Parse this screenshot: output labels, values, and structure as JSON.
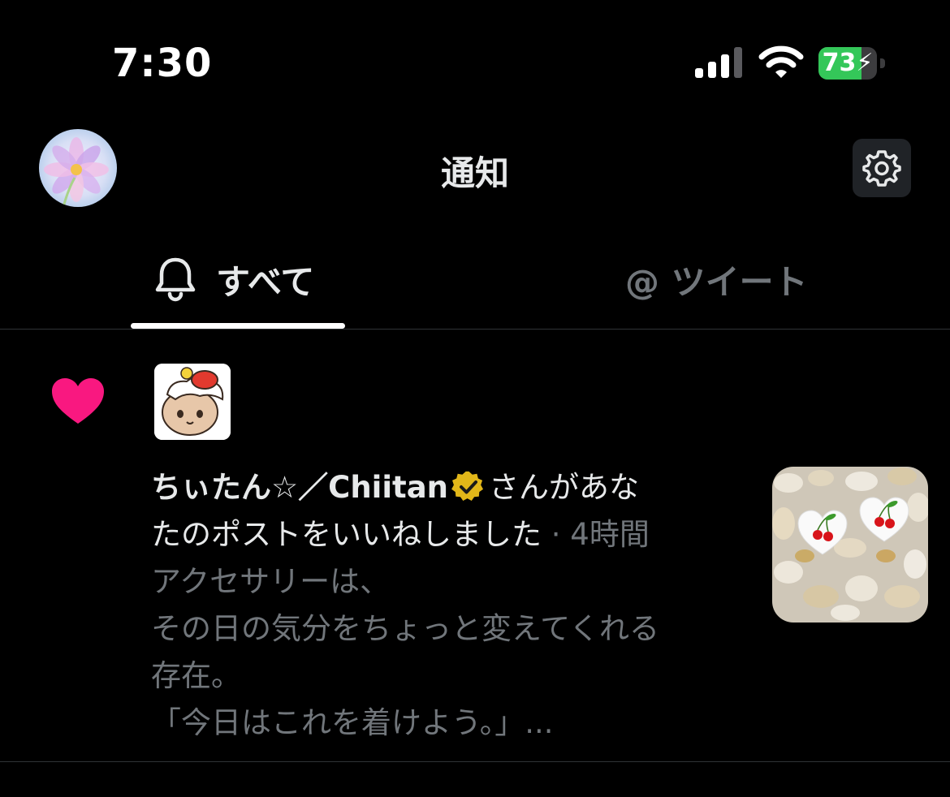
{
  "status_bar": {
    "time": "7:30",
    "battery_level": 73,
    "battery_label": "73",
    "battery_color": "#34c759",
    "charging": true
  },
  "header": {
    "title": "通知",
    "avatar_icon": "flower-avatar",
    "settings_icon": "gear-icon"
  },
  "tabs": [
    {
      "label": "すべて",
      "icon": "bell-icon",
      "selected": true
    },
    {
      "label": "@ ツイート",
      "selected": false
    }
  ],
  "notification": {
    "type_icon": "heart-icon",
    "type_color": "#f91880",
    "user_name": "ちぃたん☆／Chiitan",
    "verified": true,
    "action_part1": "さんがあな",
    "action_part2": "たのポストをいいねしました",
    "separator": " · ",
    "time_ago": "4時間",
    "preview_lines": [
      "アクセサリーは、",
      "その日の気分をちょっと変えてくれる",
      "存在。",
      "「今日はこれを着けよう。」..."
    ]
  }
}
